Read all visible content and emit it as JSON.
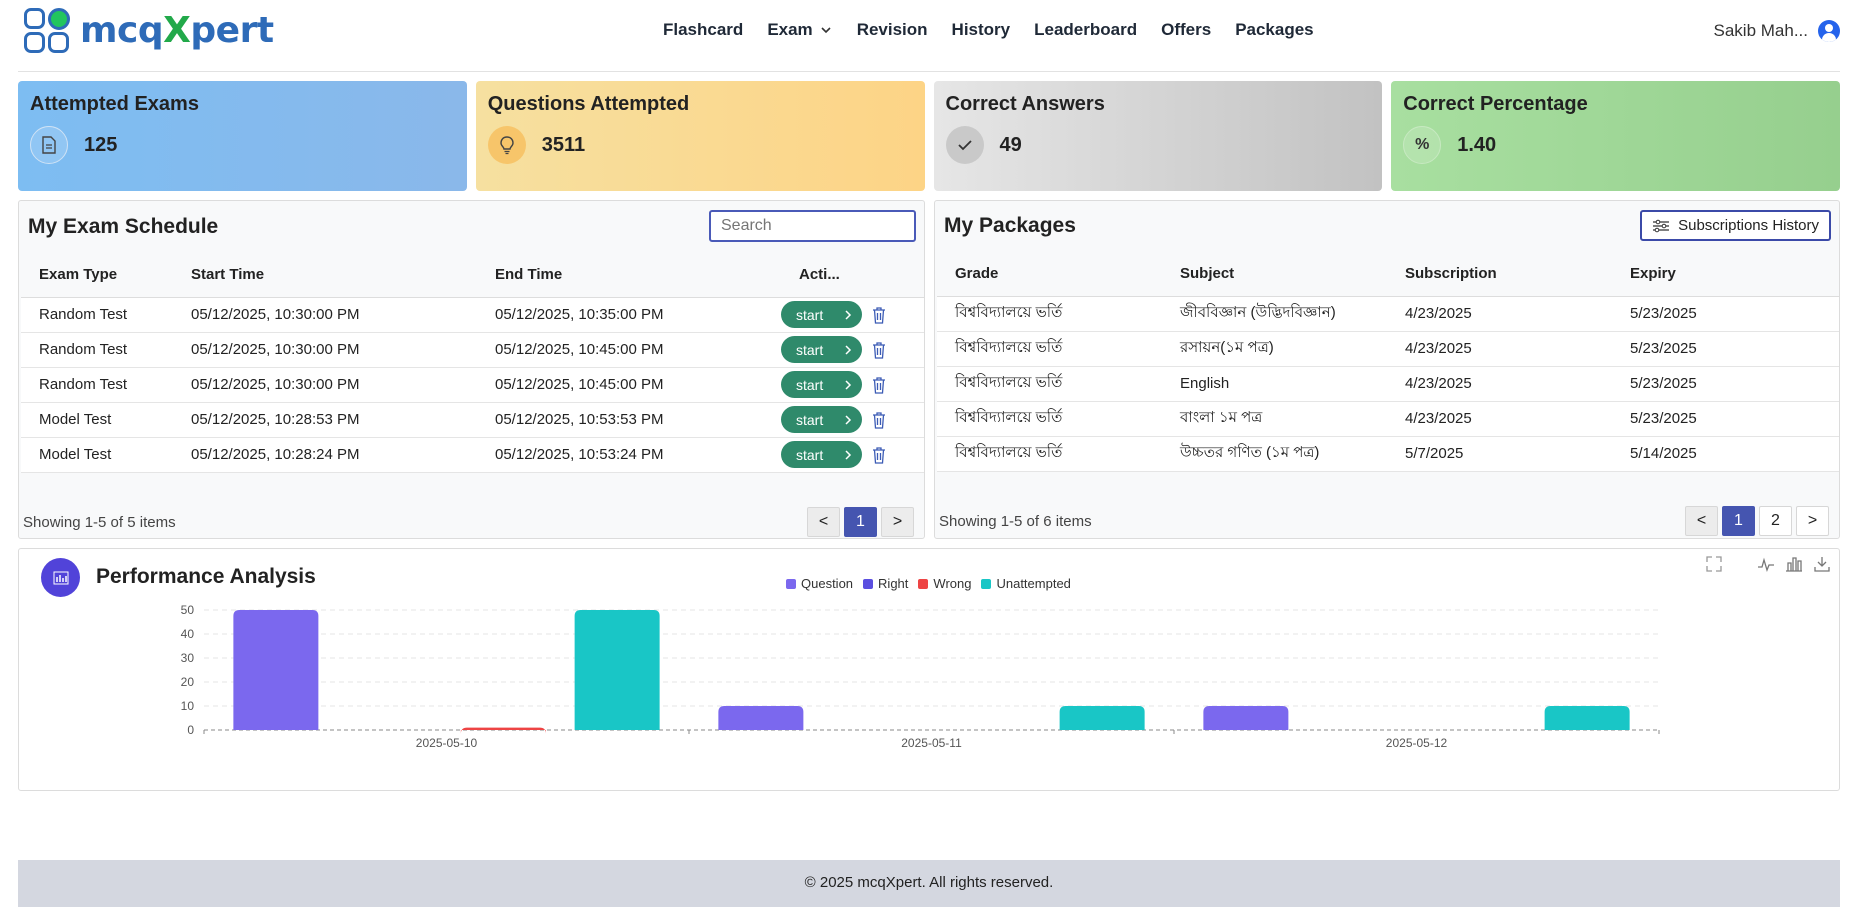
{
  "brand": {
    "name_part1": "mcq",
    "name_x": "X",
    "name_part2": "pert"
  },
  "nav": [
    {
      "label": "Flashcard"
    },
    {
      "label": "Exam",
      "dropdown": true
    },
    {
      "label": "Revision"
    },
    {
      "label": "History"
    },
    {
      "label": "Leaderboard"
    },
    {
      "label": "Offers"
    },
    {
      "label": "Packages"
    }
  ],
  "user": {
    "name": "Sakib Mah..."
  },
  "stats": [
    {
      "title": "Attempted Exams",
      "value": "125",
      "icon": "document-icon"
    },
    {
      "title": "Questions Attempted",
      "value": "3511",
      "icon": "lightbulb-icon"
    },
    {
      "title": "Correct Answers",
      "value": "49",
      "icon": "check-icon"
    },
    {
      "title": "Correct Percentage",
      "value": "1.40",
      "icon": "percent-icon"
    }
  ],
  "schedule": {
    "title": "My Exam Schedule",
    "search_placeholder": "Search",
    "columns": [
      "Exam Type",
      "Start Time",
      "End Time",
      "Acti..."
    ],
    "rows": [
      {
        "type": "Random Test",
        "start": "05/12/2025, 10:30:00 PM",
        "end": "05/12/2025, 10:35:00 PM",
        "action": "start"
      },
      {
        "type": "Random Test",
        "start": "05/12/2025, 10:30:00 PM",
        "end": "05/12/2025, 10:45:00 PM",
        "action": "start"
      },
      {
        "type": "Random Test",
        "start": "05/12/2025, 10:30:00 PM",
        "end": "05/12/2025, 10:45:00 PM",
        "action": "start"
      },
      {
        "type": "Model Test",
        "start": "05/12/2025, 10:28:53 PM",
        "end": "05/12/2025, 10:53:53 PM",
        "action": "start"
      },
      {
        "type": "Model Test",
        "start": "05/12/2025, 10:28:24 PM",
        "end": "05/12/2025, 10:53:24 PM",
        "action": "start"
      }
    ],
    "showing": "Showing 1-5 of 5 items",
    "pager": {
      "prev": "<",
      "pages": [
        "1"
      ],
      "next": ">"
    }
  },
  "packages": {
    "title": "My Packages",
    "history_button": "Subscriptions History",
    "columns": [
      "Grade",
      "Subject",
      "Subscription",
      "Expiry"
    ],
    "rows": [
      {
        "grade": "বিশ্ববিদ্যালয়ে ভর্তি",
        "subject": "জীববিজ্ঞান (উদ্ভিদবিজ্ঞান)",
        "sub": "4/23/2025",
        "exp": "5/23/2025"
      },
      {
        "grade": "বিশ্ববিদ্যালয়ে ভর্তি",
        "subject": "রসায়ন(১ম পত্র)",
        "sub": "4/23/2025",
        "exp": "5/23/2025"
      },
      {
        "grade": "বিশ্ববিদ্যালয়ে ভর্তি",
        "subject": "English",
        "sub": "4/23/2025",
        "exp": "5/23/2025"
      },
      {
        "grade": "বিশ্ববিদ্যালয়ে ভর্তি",
        "subject": "বাংলা ১ম পত্র",
        "sub": "4/23/2025",
        "exp": "5/23/2025"
      },
      {
        "grade": "বিশ্ববিদ্যালয়ে ভর্তি",
        "subject": "উচ্চতর গণিত (১ম পত্র)",
        "sub": "5/7/2025",
        "exp": "5/14/2025"
      }
    ],
    "showing": "Showing 1-5 of 6 items",
    "pager": {
      "prev": "<",
      "pages": [
        "1",
        "2"
      ],
      "next": ">"
    }
  },
  "performance": {
    "title": "Performance Analysis"
  },
  "chart_data": {
    "type": "bar",
    "categories": [
      "2025-05-10",
      "2025-05-11",
      "2025-05-12"
    ],
    "series": [
      {
        "name": "Question",
        "color": "#7b68ee",
        "values": [
          50,
          10,
          10
        ]
      },
      {
        "name": "Right",
        "color": "#5b4fe0",
        "values": [
          0,
          0,
          0
        ]
      },
      {
        "name": "Wrong",
        "color": "#ee4444",
        "values": [
          1,
          0,
          0
        ]
      },
      {
        "name": "Unattempted",
        "color": "#19c6c6",
        "values": [
          50,
          10,
          10
        ]
      }
    ],
    "yticks": [
      "0",
      "10",
      "20",
      "30",
      "40",
      "50"
    ],
    "ylim": [
      0,
      50
    ],
    "legend": "top-center",
    "grid": true
  },
  "footer": {
    "text": "© 2025 mcqXpert. All rights reserved."
  }
}
